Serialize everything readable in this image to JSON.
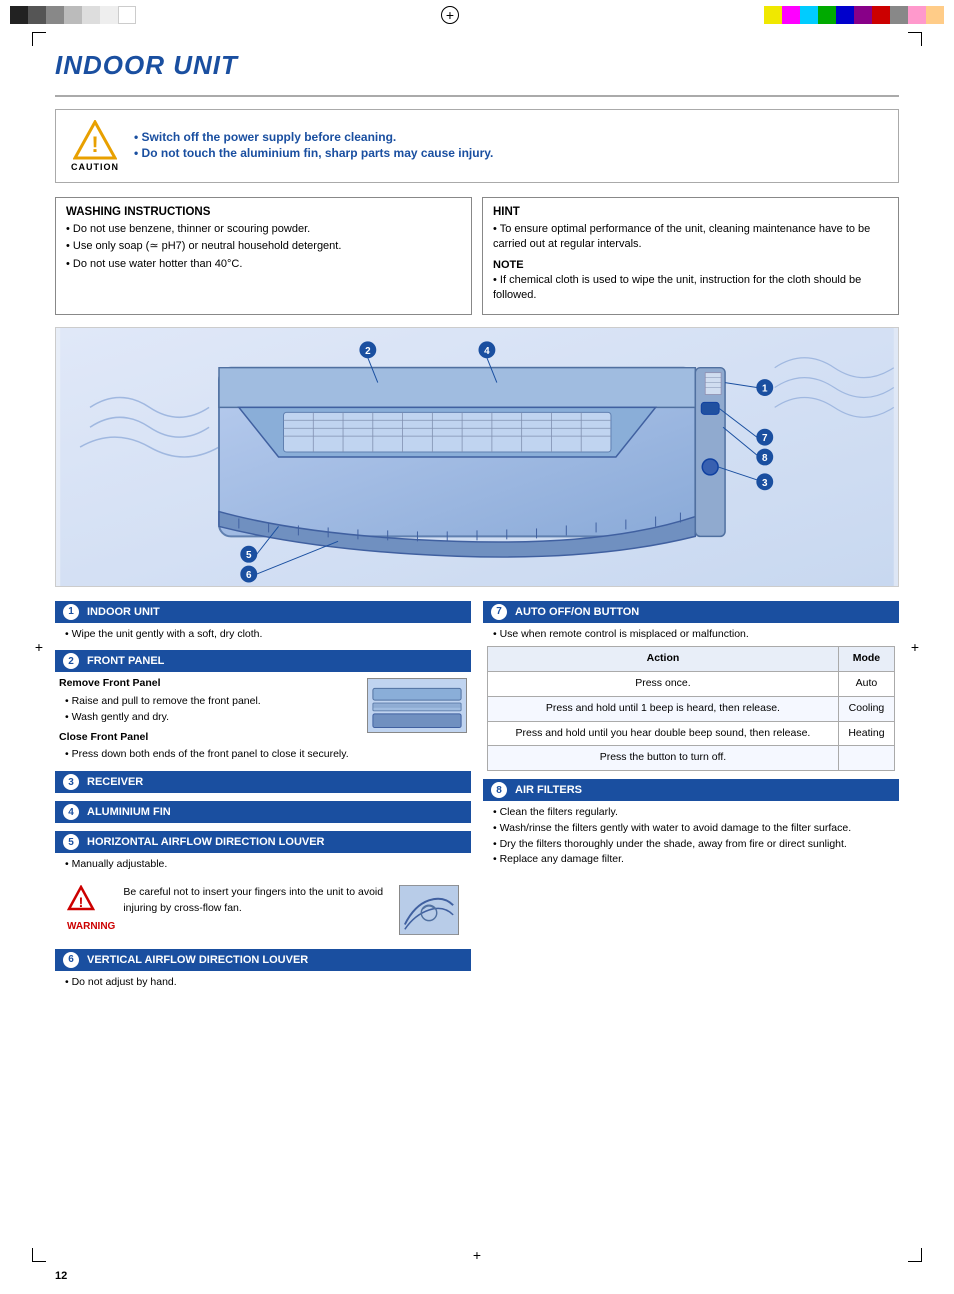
{
  "page": {
    "number": "12",
    "title": "INDOOR UNIT"
  },
  "caution": {
    "label": "CAUTION",
    "lines": [
      "Switch off the power supply before cleaning.",
      "Do not touch the aluminium fin, sharp parts may cause injury."
    ]
  },
  "washing_instructions": {
    "title": "WASHING  INSTRUCTIONS",
    "items": [
      "Do not use benzene, thinner or scouring powder.",
      "Use only soap (≃ pH7) or neutral household detergent.",
      "Do not use water hotter than 40°C."
    ]
  },
  "hint": {
    "title": "HINT",
    "text": "To ensure optimal performance of the unit, cleaning maintenance have to be carried out at regular intervals.",
    "note_title": "NOTE",
    "note_text": "If chemical cloth is used to wipe the unit, instruction for the cloth should be followed."
  },
  "components": [
    {
      "number": "1",
      "title": "INDOOR UNIT",
      "body": "Wipe the unit gently with a soft, dry cloth.",
      "type": "simple"
    },
    {
      "number": "2",
      "title": "FRONT PANEL",
      "remove_head": "Remove Front Panel",
      "remove_items": [
        "Raise and pull to remove the front panel.",
        "Wash gently and dry."
      ],
      "close_head": "Close Front Panel",
      "close_text": "Press down both ends of the front panel to close it securely.",
      "type": "front_panel"
    },
    {
      "number": "3",
      "title": "RECEIVER",
      "type": "simple_no_body"
    },
    {
      "number": "4",
      "title": "ALUMINIUM FIN",
      "type": "simple_no_body"
    },
    {
      "number": "5",
      "title": "HORIZONTAL AIRFLOW DIRECTION LOUVER",
      "manually": "Manually adjustable.",
      "warning_label": "WARNING",
      "warning_text": "Be careful not to insert your fingers into the unit to avoid injuring by cross-flow fan.",
      "type": "louver_h"
    },
    {
      "number": "6",
      "title": "VERTICAL AIRFLOW DIRECTION LOUVER",
      "body": "Do not adjust by hand.",
      "type": "simple_bullet"
    }
  ],
  "right_components": [
    {
      "number": "7",
      "title": "AUTO OFF/ON BUTTON",
      "intro": "Use when remote control is misplaced or malfunction.",
      "table": {
        "headers": [
          "Action",
          "Mode"
        ],
        "rows": [
          [
            "Press once.",
            "Auto"
          ],
          [
            "Press and hold until 1 beep is heard, then release.",
            "Cooling"
          ],
          [
            "Press and hold until you hear double beep sound, then release.",
            "Heating"
          ],
          [
            "Press the button to turn off.",
            ""
          ]
        ]
      }
    },
    {
      "number": "8",
      "title": "AIR FILTERS",
      "items": [
        "Clean the filters regularly.",
        "Wash/rinse the filters gently with water to avoid damage to the filter surface.",
        "Dry the filters thoroughly under the shade, away from fire or direct sunlight.",
        "Replace any damage filter."
      ]
    }
  ]
}
